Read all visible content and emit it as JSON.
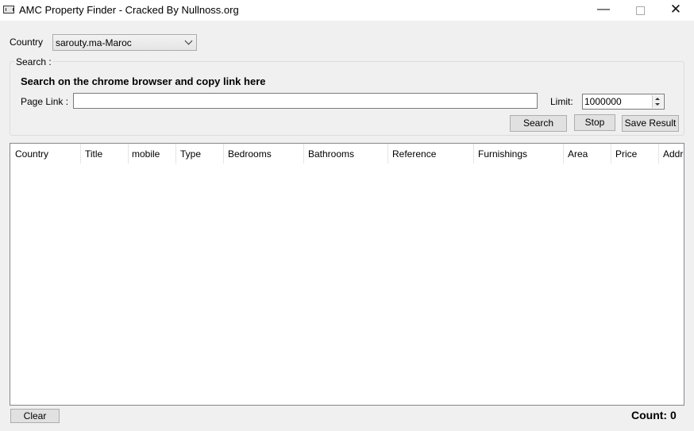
{
  "window": {
    "title": "AMC Property Finder - Cracked By Nullnoss.org",
    "minimize": "—",
    "close": "✕"
  },
  "country": {
    "label": "Country",
    "selected": "sarouty.ma-Maroc"
  },
  "search_group": {
    "legend": "Search :",
    "heading": "Search on the chrome browser and copy link here",
    "page_link_label": "Page Link :",
    "page_link_value": "",
    "limit_label": "Limit:",
    "limit_value": "1000000",
    "search_button": "Search",
    "stop_button": "Stop",
    "save_button": "Save Result"
  },
  "results": {
    "columns": [
      "Country",
      "Title",
      "mobile",
      "Type",
      "Bedrooms",
      "Bathrooms",
      "Reference",
      "Furnishings",
      "Area",
      "Price",
      "Addre"
    ],
    "rows": []
  },
  "footer": {
    "clear_button": "Clear",
    "count_text": "Count: 0"
  }
}
